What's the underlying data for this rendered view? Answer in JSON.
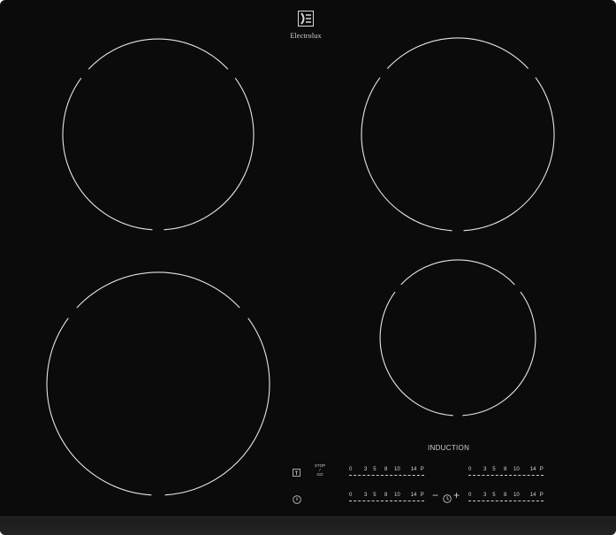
{
  "brand": {
    "name": "Electrolux",
    "logo_icon": "electrolux-logo-icon"
  },
  "panel": {
    "induction_label": "INDUCTION"
  },
  "controls": {
    "stop_go_label": "STOP\n/\nGO",
    "minus_label": "−",
    "plus_label": "+",
    "icons": {
      "lock": "key-lock-icon",
      "power": "power-icon",
      "timer": "timer-icon"
    }
  },
  "sliders": [
    {
      "id": "front-left",
      "scale": [
        "0",
        "3",
        "5",
        "8",
        "10",
        "14",
        "P"
      ]
    },
    {
      "id": "rear-right",
      "scale": [
        "0",
        "3",
        "5",
        "8",
        "10",
        "14",
        "P"
      ]
    },
    {
      "id": "rear-left",
      "scale": [
        "0",
        "3",
        "5",
        "8",
        "10",
        "14",
        "P"
      ]
    },
    {
      "id": "front-right",
      "scale": [
        "0",
        "3",
        "5",
        "8",
        "10",
        "14",
        "P"
      ]
    }
  ],
  "zones": [
    {
      "name": "rear-left"
    },
    {
      "name": "rear-right"
    },
    {
      "name": "front-left"
    },
    {
      "name": "front-right"
    }
  ],
  "colors": {
    "glass": "#0b0b0b",
    "marking": "#e6e6e6"
  }
}
